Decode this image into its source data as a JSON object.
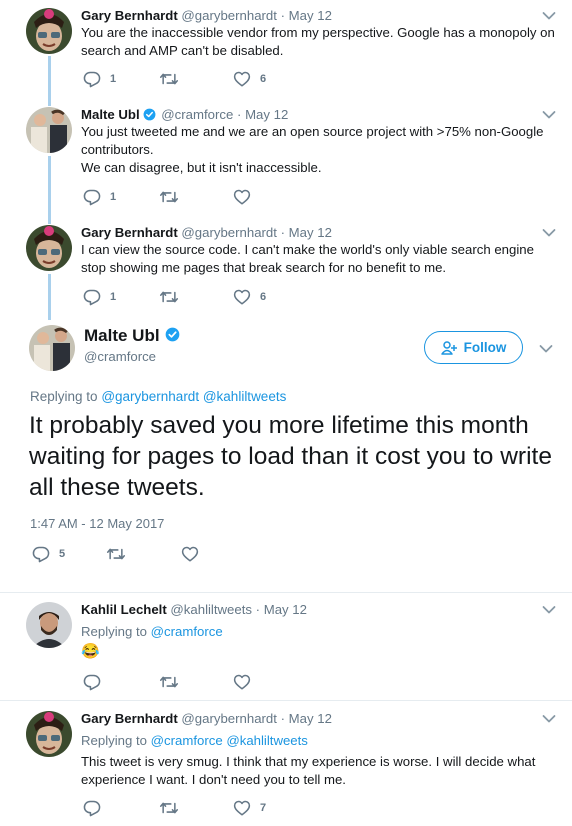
{
  "tweets": [
    {
      "name": "Gary Bernhardt",
      "handle": "@garybernhardt",
      "date": "May 12",
      "text": "You are the inaccessible vendor from my perspective. Google has a monopoly on search and AMP can't be disabled.",
      "replies": "1",
      "retweets": "",
      "likes": "6"
    },
    {
      "name": "Malte Ubl",
      "handle": "@cramforce",
      "date": "May 12",
      "text_line1": "You just tweeted me and we are an open source project with >75% non-Google contributors.",
      "text_line2": "We can disagree, but it isn't inaccessible.",
      "replies": "1",
      "retweets": "",
      "likes": ""
    },
    {
      "name": "Gary Bernhardt",
      "handle": "@garybernhardt",
      "date": "May 12",
      "text": "I can view the source code. I can't make the world's only viable search engine stop showing me pages that break search for no benefit to me.",
      "replies": "1",
      "retweets": "",
      "likes": "6"
    }
  ],
  "main_tweet": {
    "name": "Malte Ubl",
    "handle": "@cramforce",
    "follow_label": "Follow",
    "replying_prefix": "Replying to",
    "replying_to_1": "@garybernhardt",
    "replying_to_2": "@kahliltweets",
    "text": "It probably saved you more lifetime this month waiting for pages to load than it cost you to write all these tweets.",
    "timestamp": "1:47 AM - 12 May 2017",
    "replies": "5",
    "retweets": "",
    "likes": ""
  },
  "reply_tweets": [
    {
      "name": "Kahlil Lechelt",
      "handle": "@kahliltweets",
      "date": "May 12",
      "replying_prefix": "Replying to",
      "replying_to_1": "@cramforce",
      "text": "😂",
      "replies": "",
      "retweets": "",
      "likes": ""
    },
    {
      "name": "Gary Bernhardt",
      "handle": "@garybernhardt",
      "date": "May 12",
      "replying_prefix": "Replying to",
      "replying_to_1": "@cramforce",
      "replying_to_2": "@kahliltweets",
      "text": "This tweet is very smug. I think that my experience is worse. I will decide what experience I want. I don't need you to tell me.",
      "replies": "",
      "retweets": "",
      "likes": "7"
    }
  ],
  "dot": "·",
  "colors": {
    "accent": "#1b95e0",
    "muted": "#657786",
    "thread_line": "#a9d0ec",
    "text": "#14171a"
  }
}
